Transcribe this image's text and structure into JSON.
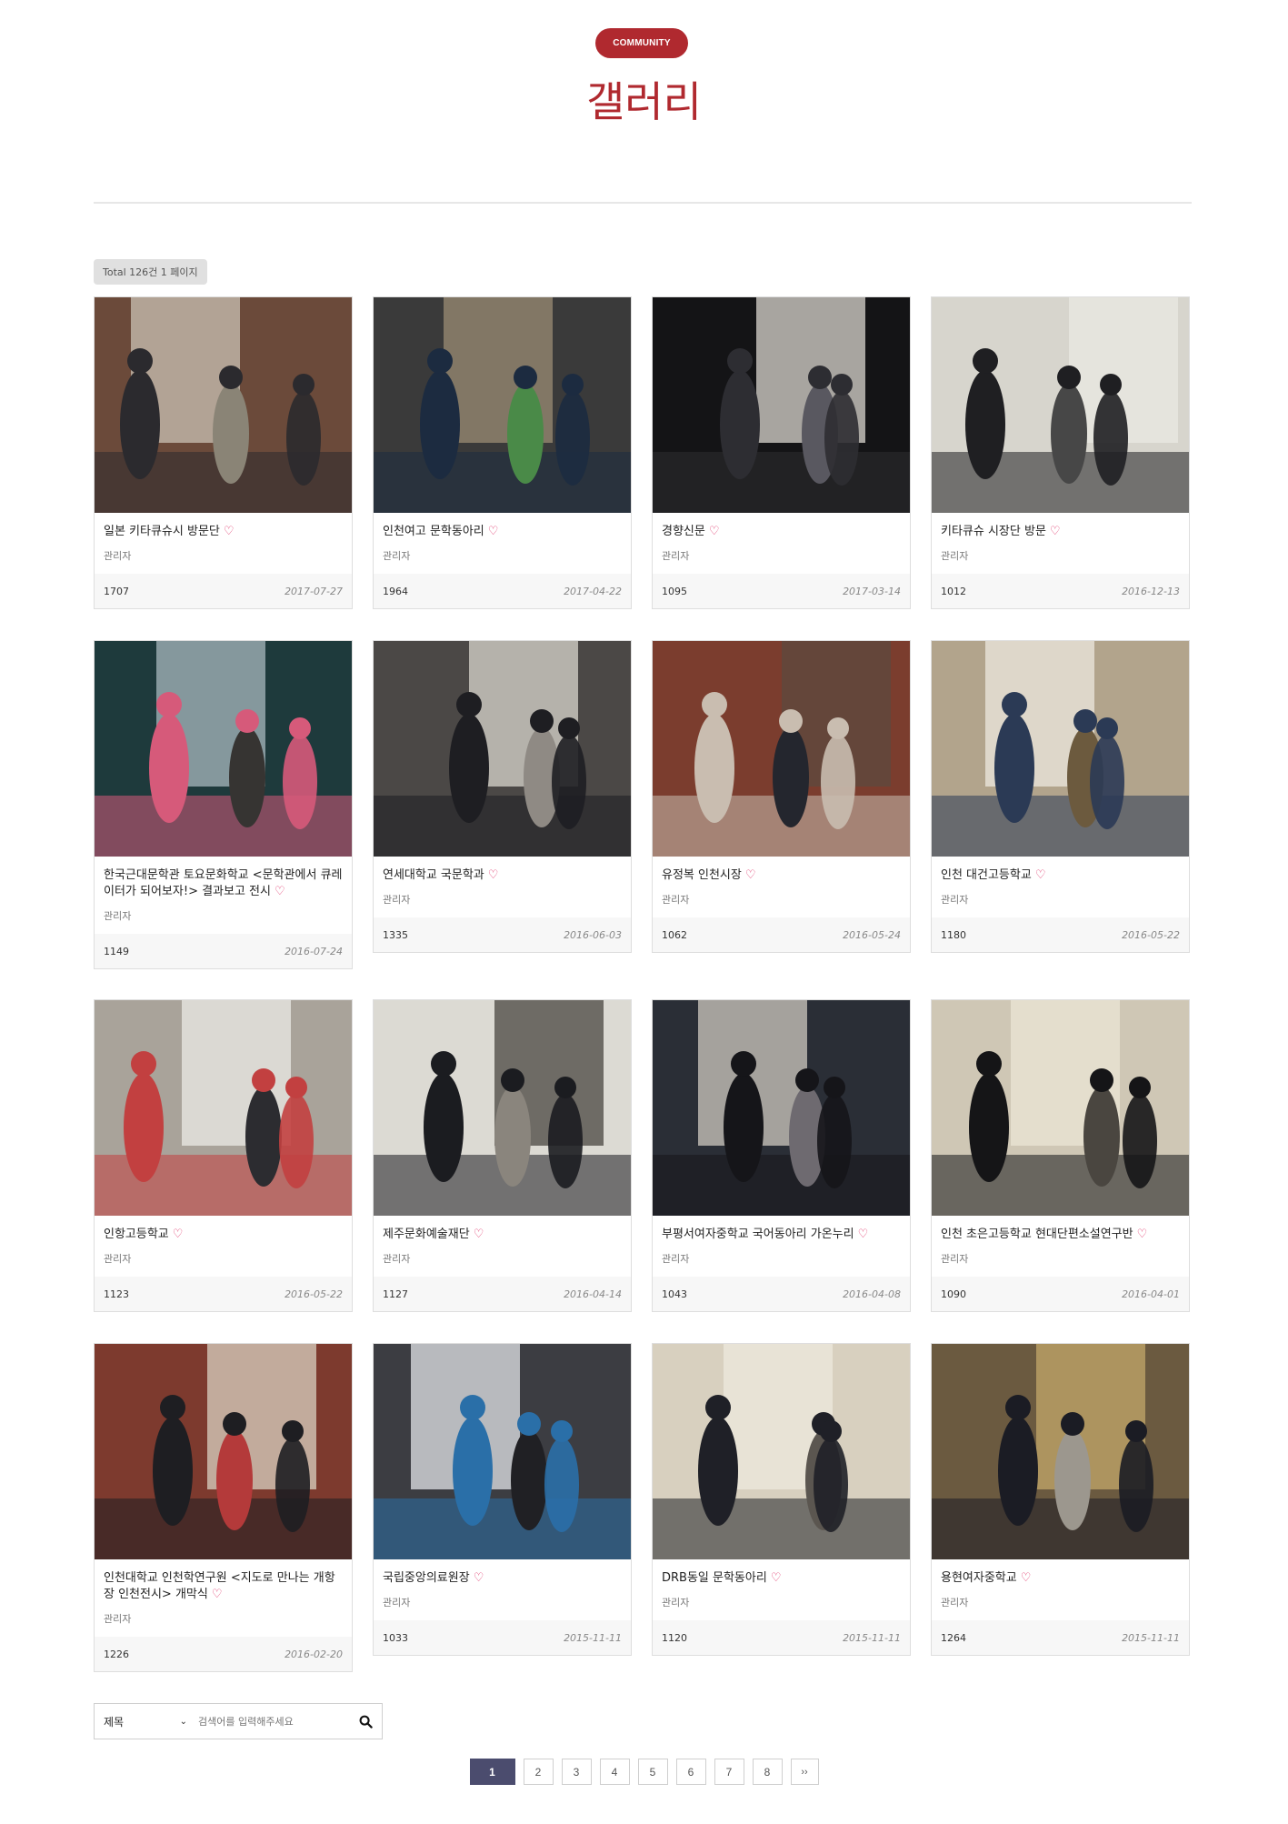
{
  "header": {
    "badge": "COMMUNITY",
    "title": "갤러리"
  },
  "board": {
    "total": "Total 126건 1 페이지"
  },
  "colors": {
    "accent": "#b0292f",
    "heart": "#e0366b",
    "active_page": "#4b4c6e"
  },
  "cards": [
    {
      "title": "일본 키타큐슈시 방문단",
      "author": "관리자",
      "views": "1707",
      "date": "2017-07-27",
      "photo": [
        "#6b4a3a",
        "#c9c2b4",
        "#2b2a2e",
        "#8a8476"
      ]
    },
    {
      "title": "인천여고 문학동아리",
      "author": "관리자",
      "views": "1964",
      "date": "2017-04-22",
      "photo": [
        "#3a3a3a",
        "#9b8c74",
        "#1c2b40",
        "#4a8a48"
      ]
    },
    {
      "title": "경향신문",
      "author": "관리자",
      "views": "1095",
      "date": "2017-03-14",
      "photo": [
        "#141416",
        "#d9d6cf",
        "#2d2d32",
        "#595860"
      ]
    },
    {
      "title": "키타큐슈 시장단 방문",
      "author": "관리자",
      "views": "1012",
      "date": "2016-12-13",
      "photo": [
        "#d7d5cd",
        "#e9e8e2",
        "#1f1f22",
        "#474747"
      ]
    },
    {
      "title": "한국근대문학관 토요문화학교 <문학관에서 큐레이터가 되어보자!> 결과보고 전시",
      "author": "관리자",
      "views": "1149",
      "date": "2016-07-24",
      "photo": [
        "#1e3a3c",
        "#a8b8be",
        "#d65a7a",
        "#363432"
      ]
    },
    {
      "title": "연세대학교 국문학과",
      "author": "관리자",
      "views": "1335",
      "date": "2016-06-03",
      "photo": [
        "#4b4846",
        "#d8d6cd",
        "#1e1e22",
        "#8f8a84"
      ]
    },
    {
      "title": "유정복 인천시장",
      "author": "관리자",
      "views": "1062",
      "date": "2016-05-24",
      "photo": [
        "#7b3d2e",
        "#5c4a3f",
        "#c9bdb0",
        "#24262e"
      ]
    },
    {
      "title": "인천 대건고등학교",
      "author": "관리자",
      "views": "1180",
      "date": "2016-05-22",
      "photo": [
        "#b2a48c",
        "#ece8df",
        "#2b3a55",
        "#6c5a3e"
      ]
    },
    {
      "title": "인항고등학교",
      "author": "관리자",
      "views": "1123",
      "date": "2016-05-22",
      "photo": [
        "#a9a39a",
        "#ecebe6",
        "#c24040",
        "#2c2c30"
      ]
    },
    {
      "title": "제주문화예술재단",
      "author": "관리자",
      "views": "1127",
      "date": "2016-04-14",
      "photo": [
        "#dcdad3",
        "#4a4640",
        "#1b1c20",
        "#8a857d"
      ]
    },
    {
      "title": "부평서여자중학교 국어동아리 가온누리",
      "author": "관리자",
      "views": "1043",
      "date": "2016-04-08",
      "photo": [
        "#2a2e36",
        "#cfcac0",
        "#151519",
        "#6e6a70"
      ]
    },
    {
      "title": "인천 초은고등학교 현대단편소설연구반",
      "author": "관리자",
      "views": "1090",
      "date": "2016-04-01",
      "photo": [
        "#cfc7b5",
        "#ebe5d6",
        "#151517",
        "#4a4640"
      ]
    },
    {
      "title": "인천대학교 인천학연구원 <지도로 만나는 개항장 인천전시> 개막식",
      "author": "관리자",
      "views": "1226",
      "date": "2016-02-20",
      "photo": [
        "#7d3a2e",
        "#d9d2c2",
        "#1e1e22",
        "#b43a3a"
      ]
    },
    {
      "title": "국립중앙의료원장",
      "author": "관리자",
      "views": "1033",
      "date": "2015-11-11",
      "photo": [
        "#3c3d42",
        "#e1e4e8",
        "#2a6fa8",
        "#202024"
      ]
    },
    {
      "title": "DRB동일 문학동아리",
      "author": "관리자",
      "views": "1120",
      "date": "2015-11-11",
      "photo": [
        "#d8d0bf",
        "#eee9dd",
        "#1f2027",
        "#5b5650"
      ]
    },
    {
      "title": "용현여자중학교",
      "author": "관리자",
      "views": "1264",
      "date": "2015-11-11",
      "photo": [
        "#6b5a40",
        "#c3a86a",
        "#1b1c24",
        "#9c978e"
      ]
    }
  ],
  "search": {
    "field": "제목",
    "placeholder": "검색어를 입력해주세요"
  },
  "pagination": {
    "pages": [
      "1",
      "2",
      "3",
      "4",
      "5",
      "6",
      "7",
      "8"
    ],
    "current": "1",
    "next_icon": "double-chevron-right-icon",
    "next_label": "››"
  }
}
